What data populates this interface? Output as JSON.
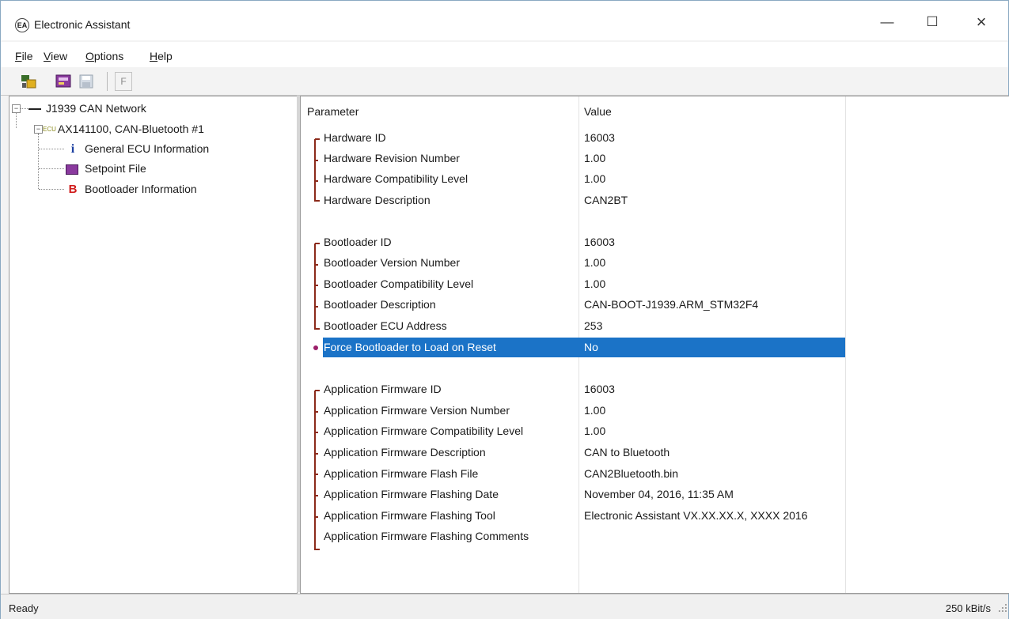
{
  "window": {
    "title": "Electronic Assistant",
    "app_icon_text": "EA"
  },
  "menubar": {
    "items": [
      {
        "mnemonic": "F",
        "rest": "ile"
      },
      {
        "mnemonic": "V",
        "rest": "iew"
      },
      {
        "mnemonic": "O",
        "rest": "ptions"
      },
      {
        "mnemonic": "H",
        "rest": "elp"
      }
    ]
  },
  "toolbar": {
    "f_label": "F"
  },
  "tree": {
    "network": "J1939 CAN Network",
    "ecu_prefix": "ECU",
    "ecu": "AX141100, CAN-Bluetooth #1",
    "children": [
      {
        "icon_text": "i",
        "label": "General ECU Information",
        "icon_color": "#1b3fa0"
      },
      {
        "icon_text": "",
        "label": "Setpoint File",
        "icon_color": "#8a3a9e"
      },
      {
        "icon_text": "B",
        "label": "Bootloader Information",
        "icon_color": "#d01c1c"
      }
    ]
  },
  "grid": {
    "header_param": "Parameter",
    "header_value": "Value",
    "hardware": [
      {
        "p": "Hardware ID",
        "v": "16003"
      },
      {
        "p": "Hardware Revision Number",
        "v": "1.00"
      },
      {
        "p": "Hardware Compatibility Level",
        "v": "1.00"
      },
      {
        "p": "Hardware Description",
        "v": "CAN2BT"
      }
    ],
    "bootloader": [
      {
        "p": "Bootloader ID",
        "v": "16003"
      },
      {
        "p": "Bootloader Version Number",
        "v": "1.00"
      },
      {
        "p": "Bootloader Compatibility Level",
        "v": "1.00"
      },
      {
        "p": "Bootloader Description",
        "v": "CAN-BOOT-J1939.ARM_STM32F4"
      },
      {
        "p": "Bootloader ECU Address",
        "v": "253"
      }
    ],
    "force": {
      "p": "Force Bootloader to Load on Reset",
      "v": "No"
    },
    "application": [
      {
        "p": "Application Firmware ID",
        "v": "16003"
      },
      {
        "p": "Application Firmware Version Number",
        "v": "1.00"
      },
      {
        "p": "Application Firmware Compatibility Level",
        "v": "1.00"
      },
      {
        "p": "Application Firmware Description",
        "v": "CAN to Bluetooth"
      },
      {
        "p": "Application Firmware Flash File",
        "v": "CAN2Bluetooth.bin"
      },
      {
        "p": "Application Firmware Flashing Date",
        "v": "November 04, 2016, 11:35 AM"
      },
      {
        "p": "Application Firmware Flashing Tool",
        "v": "Electronic Assistant VX.XX.XX.X, XXXX 2016"
      },
      {
        "p": "Application Firmware Flashing Comments",
        "v": ""
      }
    ]
  },
  "status": {
    "left": "Ready",
    "right": "250 kBit/s"
  },
  "colors": {
    "selection": "#1b73c7",
    "bracket": "#8b2a1a",
    "selection_marker": "#9b1f6a"
  }
}
